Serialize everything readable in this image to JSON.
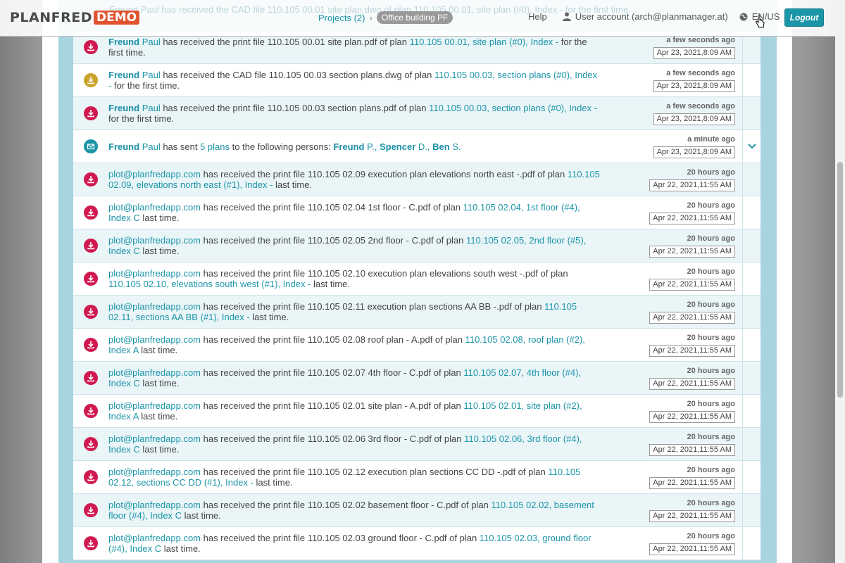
{
  "topbar": {
    "logo_main": "PLANFRED",
    "logo_badge": "DEMO",
    "breadcrumb_projects": "Projects (2)",
    "breadcrumb_current": "Office building PF",
    "help": "Help",
    "user_account": "User account (arch@planmanager.at)",
    "language": "EN/US",
    "logout": "Logout"
  },
  "ghost_text": "Freund Paul has received the CAD file 110.105 00.01 site plan.dwg of plan 110.105 00.01, site plan (#0), Index - for the first time.",
  "icons": {
    "print": "print-download-icon",
    "cad": "cad-download-icon",
    "mail": "envelope-icon"
  },
  "colors": {
    "accent": "#1b95a8",
    "print_icon": "#d0194f",
    "cad_icon": "#c9a22a"
  },
  "rows": [
    {
      "icon": "print",
      "prefix_bold": "Freund",
      "prefix_rest": "Paul",
      "text": " has received the print file 110.105 00.01 site plan.pdf of plan ",
      "link": "110.105 00.01, site plan (#0), Index -",
      "suffix": " for the first time.",
      "ago": "a few seconds ago",
      "date": "Apr 23, 2021,8:09 AM"
    },
    {
      "icon": "cad",
      "prefix_bold": "Freund",
      "prefix_rest": "Paul",
      "text": " has received the CAD file 110.105 00.03 section plans.dwg of plan ",
      "link": "110.105 00.03, section plans (#0), Index -",
      "suffix": " for the first time.",
      "ago": "a few seconds ago",
      "date": "Apr 23, 2021,8:09 AM"
    },
    {
      "icon": "print",
      "prefix_bold": "Freund",
      "prefix_rest": "Paul",
      "text": " has received the print file 110.105 00.03 section plans.pdf of plan ",
      "link": "110.105 00.03, section plans (#0), Index -",
      "suffix": " for the first time.",
      "ago": "a few seconds ago",
      "date": "Apr 23, 2021,8:09 AM"
    },
    {
      "icon": "mail",
      "prefix_bold": "Freund",
      "prefix_rest": "Paul",
      "text": " has sent ",
      "link": "5 plans",
      "suffix": " to the following persons: ",
      "recipients": [
        {
          "bold": "Freund",
          "rest": "P.,"
        },
        {
          "bold": "Spencer",
          "rest": "D.,"
        },
        {
          "bold": "Ben",
          "rest": "S."
        }
      ],
      "ago": "a minute ago",
      "date": "Apr 23, 2021,8:09 AM",
      "expandable": true
    },
    {
      "icon": "print",
      "email": "plot@planfredapp.com",
      "text": " has received the print file 110.105 02.09 execution plan elevations north east -.pdf of plan ",
      "link": "110.105 02.09, elevations north east (#1), Index -",
      "suffix": " last time.",
      "ago": "20 hours ago",
      "date": "Apr 22, 2021,11:55 AM"
    },
    {
      "icon": "print",
      "email": "plot@planfredapp.com",
      "text": " has received the print file 110.105 02.04 1st floor - C.pdf of plan ",
      "link": "110.105 02.04, 1st floor (#4), Index C",
      "suffix": " last time.",
      "ago": "20 hours ago",
      "date": "Apr 22, 2021,11:55 AM"
    },
    {
      "icon": "print",
      "email": "plot@planfredapp.com",
      "text": " has received the print file 110.105 02.05 2nd floor - C.pdf of plan ",
      "link": "110.105 02.05, 2nd floor (#5), Index C",
      "suffix": " last time.",
      "ago": "20 hours ago",
      "date": "Apr 22, 2021,11:55 AM"
    },
    {
      "icon": "print",
      "email": "plot@planfredapp.com",
      "text": " has received the print file 110.105 02.10 execution plan elevations south west -.pdf of plan ",
      "link": "110.105 02.10, elevations south west (#1), Index -",
      "suffix": " last time.",
      "ago": "20 hours ago",
      "date": "Apr 22, 2021,11:55 AM"
    },
    {
      "icon": "print",
      "email": "plot@planfredapp.com",
      "text": " has received the print file 110.105 02.11 execution plan sections AA BB -.pdf of plan ",
      "link": "110.105 02.11, sections AA BB (#1), Index -",
      "suffix": " last time.",
      "ago": "20 hours ago",
      "date": "Apr 22, 2021,11:55 AM"
    },
    {
      "icon": "print",
      "email": "plot@planfredapp.com",
      "text": " has received the print file 110.105 02.08 roof plan - A.pdf of plan ",
      "link": "110.105 02.08, roof plan (#2), Index A",
      "suffix": " last time.",
      "ago": "20 hours ago",
      "date": "Apr 22, 2021,11:55 AM"
    },
    {
      "icon": "print",
      "email": "plot@planfredapp.com",
      "text": " has received the print file 110.105 02.07 4th floor - C.pdf of plan ",
      "link": "110.105 02.07, 4th floor (#4), Index C",
      "suffix": " last time.",
      "ago": "20 hours ago",
      "date": "Apr 22, 2021,11:55 AM"
    },
    {
      "icon": "print",
      "email": "plot@planfredapp.com",
      "text": " has received the print file 110.105 02.01 site plan - A.pdf of plan ",
      "link": "110.105 02.01, site plan (#2), Index A",
      "suffix": " last time.",
      "ago": "20 hours ago",
      "date": "Apr 22, 2021,11:55 AM"
    },
    {
      "icon": "print",
      "email": "plot@planfredapp.com",
      "text": " has received the print file 110.105 02.06 3rd floor - C.pdf of plan ",
      "link": "110.105 02.06, 3rd floor (#4), Index C",
      "suffix": " last time.",
      "ago": "20 hours ago",
      "date": "Apr 22, 2021,11:55 AM"
    },
    {
      "icon": "print",
      "email": "plot@planfredapp.com",
      "text": " has received the print file 110.105 02.12 execution plan sections CC DD -.pdf of plan ",
      "link": "110.105 02.12, sections CC DD (#1), Index -",
      "suffix": " last time.",
      "ago": "20 hours ago",
      "date": "Apr 22, 2021,11:55 AM"
    },
    {
      "icon": "print",
      "email": "plot@planfredapp.com",
      "text": " has received the print file 110.105 02.02 basement floor - C.pdf of plan ",
      "link": "110.105 02.02, basement floor (#4), Index C",
      "suffix": " last time.",
      "ago": "20 hours ago",
      "date": "Apr 22, 2021,11:55 AM"
    },
    {
      "icon": "print",
      "email": "plot@planfredapp.com",
      "text": " has received the print file 110.105 02.03 ground floor - C.pdf of plan ",
      "link": "110.105 02.03, ground floor (#4), Index C",
      "suffix": " last time.",
      "ago": "20 hours ago",
      "date": "Apr 22, 2021,11:55 AM"
    }
  ]
}
